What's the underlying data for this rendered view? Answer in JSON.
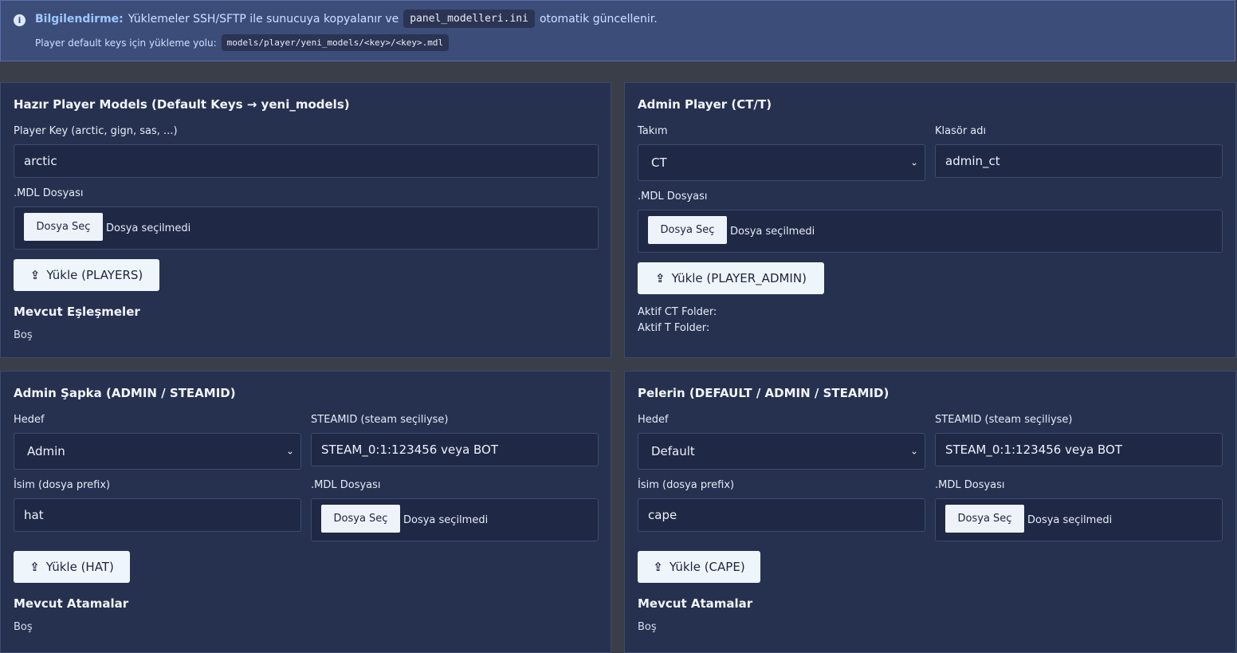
{
  "info": {
    "icon": "info-icon",
    "title": "Bilgilendirme:",
    "line1_text": "Yüklemeler SSH/SFTP ile sunucuya kopyalanır ve",
    "line1_code": "panel_modelleri.ini",
    "line1_suffix": "otomatik güncellenir.",
    "line2_text": "Player default keys için yükleme yolu:",
    "line2_code": "models/player/yeni_models/<key>/<key>.mdl"
  },
  "players": {
    "title": "Hazır Player Models (Default Keys → yeni_models)",
    "key_label": "Player Key (arctic, gign, sas, ...)",
    "key_value": "arctic",
    "mdl_label": ".MDL Dosyası",
    "file_button": "Dosya Seç",
    "file_status": "Dosya seçilmedi",
    "upload_button": "Yükle (PLAYERS)",
    "mappings_title": "Mevcut Eşleşmeler",
    "mappings_empty": "Boş"
  },
  "admin_player": {
    "title": "Admin Player (CT/T)",
    "team_label": "Takım",
    "team_value": "CT",
    "folder_label": "Klasör adı",
    "folder_value": "admin_ct",
    "mdl_label": ".MDL Dosyası",
    "file_button": "Dosya Seç",
    "file_status": "Dosya seçilmedi",
    "upload_button": "Yükle (PLAYER_ADMIN)",
    "active_ct": "Aktif CT Folder:",
    "active_t": "Aktif T Folder:"
  },
  "hat": {
    "title": "Admin Şapka (ADMIN / STEAMID)",
    "target_label": "Hedef",
    "target_value": "Admin",
    "steamid_label": "STEAMID (steam seçiliyse)",
    "steamid_placeholder": "STEAM_0:1:123456 veya BOT",
    "name_label": "İsim (dosya prefix)",
    "name_value": "hat",
    "mdl_label": ".MDL Dosyası",
    "file_button": "Dosya Seç",
    "file_status": "Dosya seçilmedi",
    "upload_button": "Yükle (HAT)",
    "assign_title": "Mevcut Atamalar",
    "assign_empty": "Boş"
  },
  "cape": {
    "title": "Pelerin (DEFAULT / ADMIN / STEAMID)",
    "target_label": "Hedef",
    "target_value": "Default",
    "steamid_label": "STEAMID (steam seçiliyse)",
    "steamid_placeholder": "STEAM_0:1:123456 veya BOT",
    "name_label": "İsim (dosya prefix)",
    "name_value": "cape",
    "mdl_label": ".MDL Dosyası",
    "file_button": "Dosya Seç",
    "file_status": "Dosya seçilmedi",
    "upload_button": "Yükle (CAPE)",
    "assign_title": "Mevcut Atamalar",
    "assign_empty": "Boş"
  },
  "icons": {
    "upload": "upload-icon",
    "chevron": "chevron-down-icon"
  }
}
